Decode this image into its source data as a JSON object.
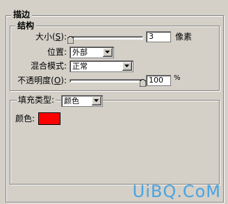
{
  "stroke_group": {
    "title": "描边"
  },
  "structure_group": {
    "title": "结构",
    "size": {
      "label": "大小(",
      "mnemonic": "S",
      "label_end": "):",
      "value": "3",
      "unit": "像素",
      "slider_fraction": 0.02
    },
    "position": {
      "label": "位置:",
      "selected": "外部"
    },
    "blend_mode": {
      "label": "混合模式:",
      "selected": "正常"
    },
    "opacity": {
      "label": "不透明度(",
      "mnemonic": "O",
      "label_end": "):",
      "value": "100",
      "unit": "%",
      "slider_fraction": 1.0
    }
  },
  "fill_group": {
    "fill_type_label": "填充类型:",
    "fill_type_selected": "颜色",
    "color_label": "颜色:",
    "color": "#ff0000"
  },
  "watermark": "UiBQ.CoM",
  "colors": {
    "panel_bg": "#d4d0c8",
    "watermark": "#4aa3e0"
  }
}
